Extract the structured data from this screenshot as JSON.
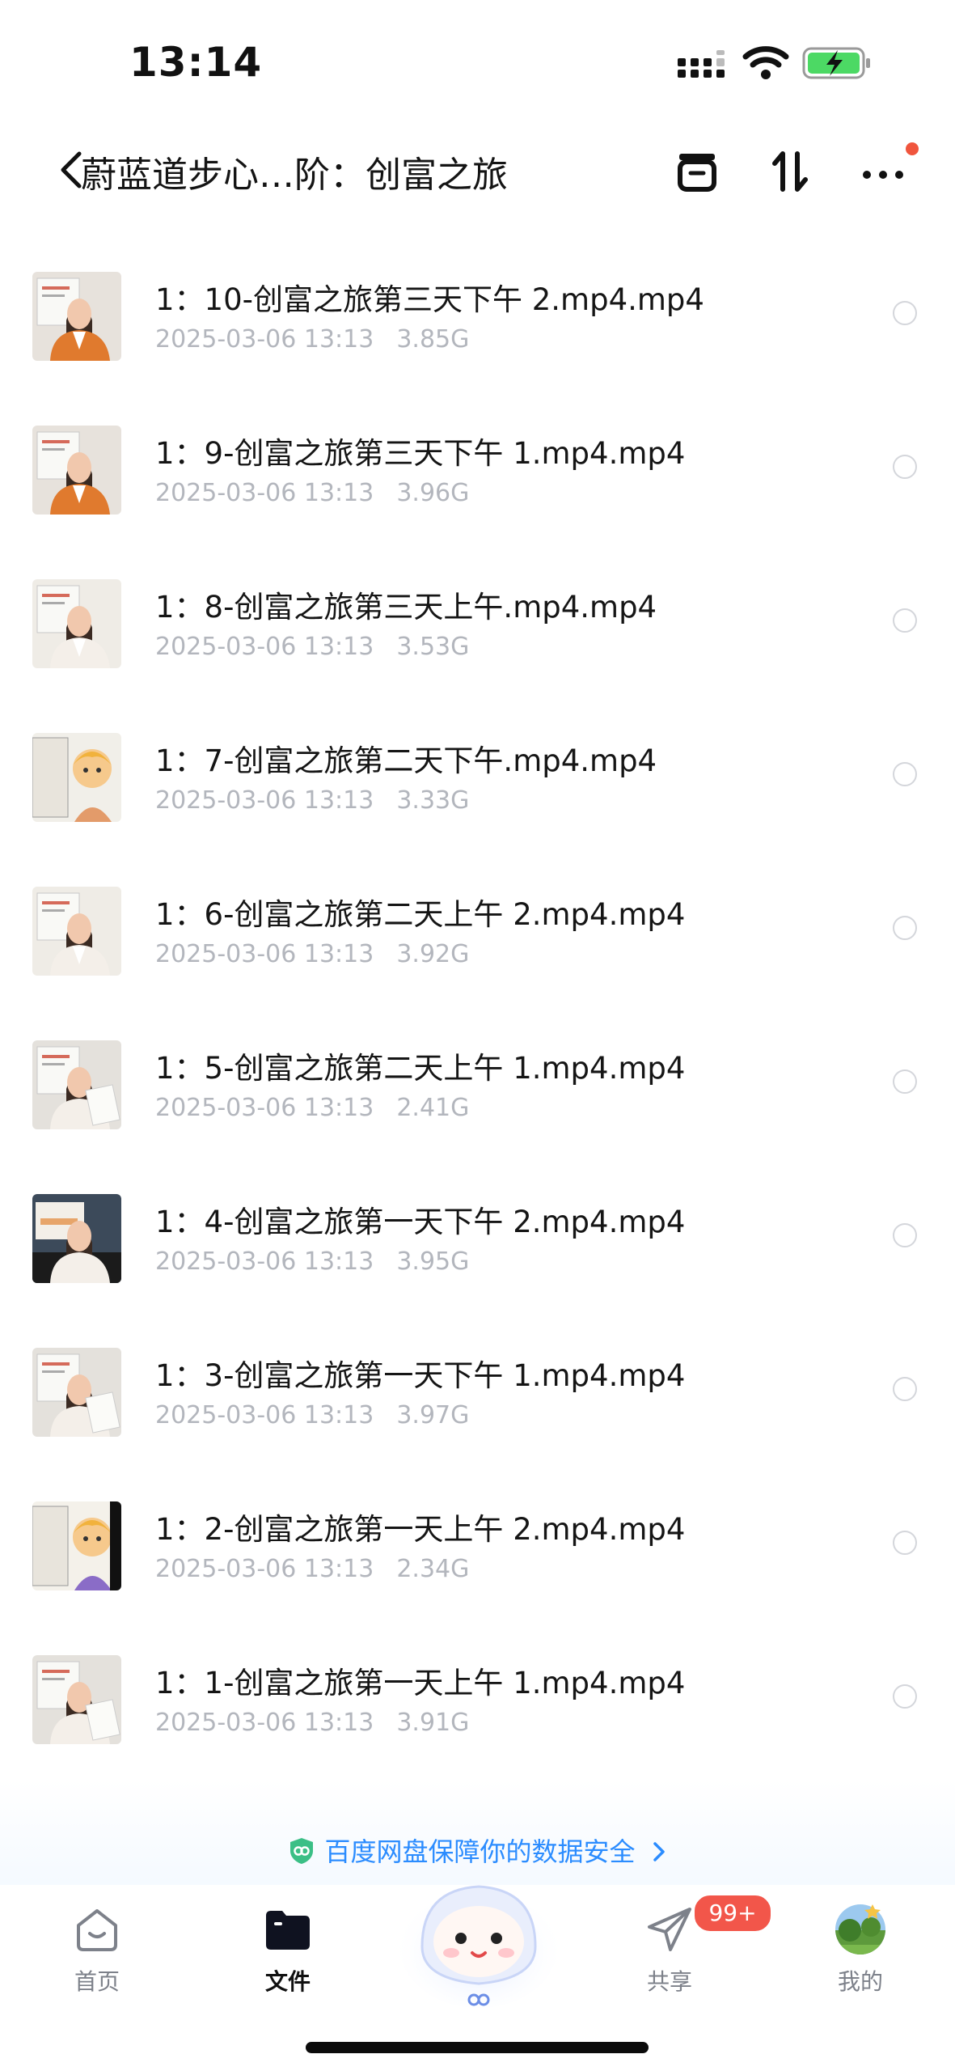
{
  "status_bar": {
    "time": "13:14"
  },
  "header": {
    "title": "蔚蓝道步心…阶：创富之旅"
  },
  "files": [
    {
      "name": "1：10-创富之旅第三天下午 2.mp4.mp4",
      "date": "2025-03-06 13:13",
      "size": "3.85G",
      "thumb": "speaker-orange"
    },
    {
      "name": "1：9-创富之旅第三天下午 1.mp4.mp4",
      "date": "2025-03-06 13:13",
      "size": "3.96G",
      "thumb": "speaker-orange"
    },
    {
      "name": "1：8-创富之旅第三天上午.mp4.mp4",
      "date": "2025-03-06 13:13",
      "size": "3.53G",
      "thumb": "speaker-white"
    },
    {
      "name": "1：7-创富之旅第二天下午.mp4.mp4",
      "date": "2025-03-06 13:13",
      "size": "3.33G",
      "thumb": "cartoon-board"
    },
    {
      "name": "1：6-创富之旅第二天上午 2.mp4.mp4",
      "date": "2025-03-06 13:13",
      "size": "3.92G",
      "thumb": "speaker-white"
    },
    {
      "name": "1：5-创富之旅第二天上午 1.mp4.mp4",
      "date": "2025-03-06 13:13",
      "size": "2.41G",
      "thumb": "speaker-paper"
    },
    {
      "name": "1：4-创富之旅第一天下午 2.mp4.mp4",
      "date": "2025-03-06 13:13",
      "size": "3.95G",
      "thumb": "speaker-screen"
    },
    {
      "name": "1：3-创富之旅第一天下午 1.mp4.mp4",
      "date": "2025-03-06 13:13",
      "size": "3.97G",
      "thumb": "speaker-paper"
    },
    {
      "name": "1：2-创富之旅第一天上午 2.mp4.mp4",
      "date": "2025-03-06 13:13",
      "size": "2.34G",
      "thumb": "cartoon-boy"
    },
    {
      "name": "1：1-创富之旅第一天上午 1.mp4.mp4",
      "date": "2025-03-06 13:13",
      "size": "3.91G",
      "thumb": "speaker-paper"
    }
  ],
  "banner": {
    "text": "百度网盘保障你的数据安全"
  },
  "tabs": [
    {
      "label": "首页",
      "icon": "home-icon",
      "active": false
    },
    {
      "label": "文件",
      "icon": "folder-icon",
      "active": true
    },
    {
      "label": "共享",
      "icon": "paper-plane-icon",
      "active": false,
      "badge": "99+"
    },
    {
      "label": "我的",
      "icon": "avatar",
      "active": false
    }
  ],
  "colors": {
    "accent": "#2b8cff",
    "badge": "#f2564a",
    "meta_text": "#b3b6bd"
  }
}
